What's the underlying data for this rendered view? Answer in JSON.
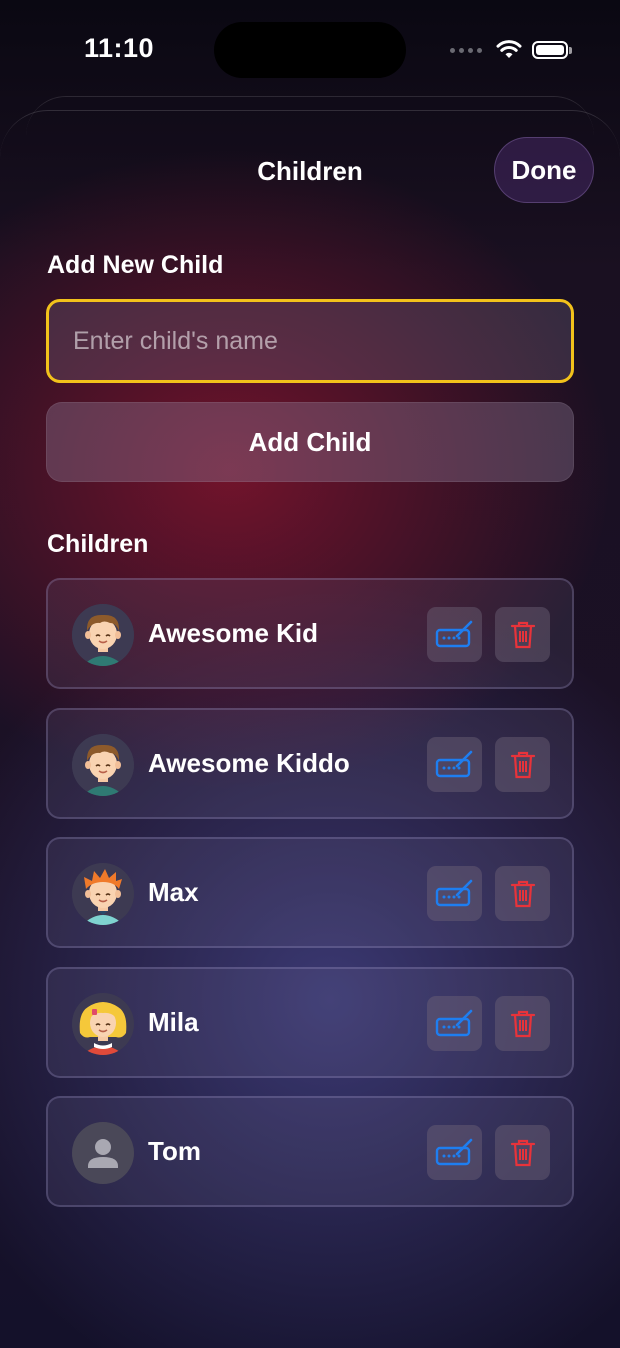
{
  "status_bar": {
    "time": "11:10"
  },
  "nav": {
    "title": "Children",
    "done_label": "Done"
  },
  "add_section": {
    "label": "Add New Child",
    "input_placeholder": "Enter child's name",
    "input_value": "",
    "add_button_label": "Add Child"
  },
  "list_section": {
    "label": "Children",
    "children": [
      {
        "name": "Awesome Kid",
        "avatar": "boy-brown-hair-avatar"
      },
      {
        "name": "Awesome Kiddo",
        "avatar": "boy-brown-hair-avatar"
      },
      {
        "name": "Max",
        "avatar": "boy-orange-hair-avatar"
      },
      {
        "name": "Mila",
        "avatar": "girl-blonde-hair-avatar"
      },
      {
        "name": "Tom",
        "avatar": "default-person-icon"
      }
    ]
  },
  "colors": {
    "accent_input_border": "#f2c21b",
    "edit_icon": "#1e7ef0",
    "delete_icon": "#e8333a"
  },
  "icons": {
    "edit": "keyboard-pencil-icon",
    "delete": "trash-icon"
  }
}
